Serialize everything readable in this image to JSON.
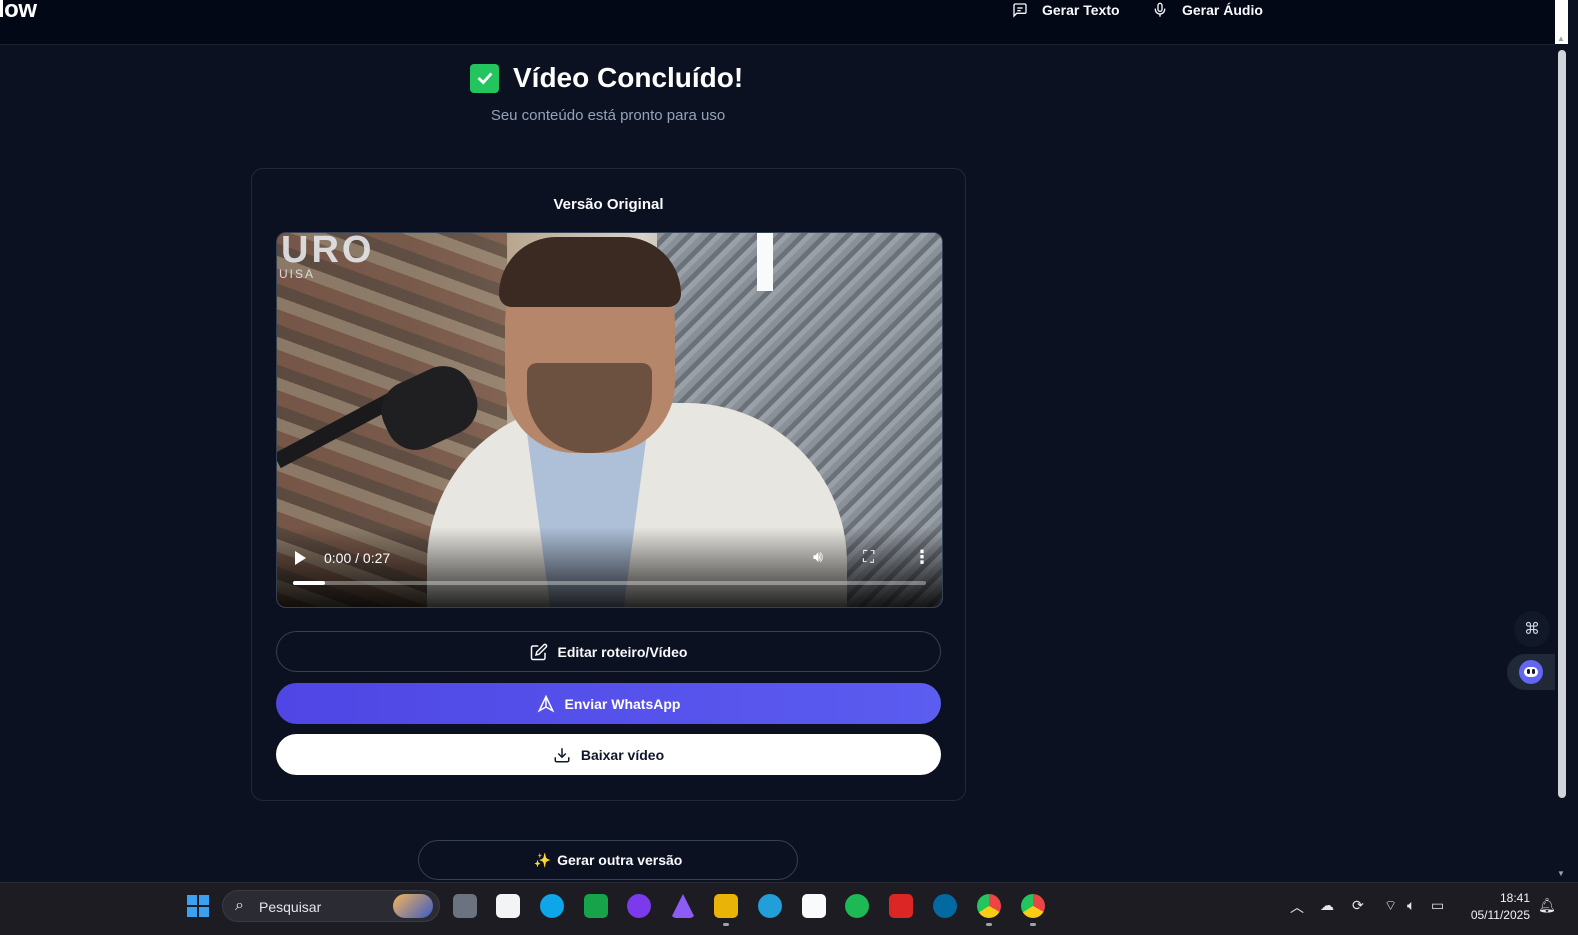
{
  "nav": {
    "brand": "low",
    "gerar_texto": "Gerar Texto",
    "gerar_audio": "Gerar Áudio"
  },
  "hero": {
    "title": "Vídeo Concluído!",
    "subtitle": "Seu conteúdo está pronto para uso"
  },
  "card": {
    "title": "Versão Original",
    "video": {
      "sign_text": "URO",
      "sign_subtext": "UISA",
      "time": "0:00 / 0:27",
      "progress": 0.05
    },
    "buttons": {
      "edit": "Editar roteiro/Vídeo",
      "whatsapp": "Enviar WhatsApp",
      "download": "Baixar vídeo"
    }
  },
  "another_version": {
    "icon": "✨",
    "label": "Gerar outra versão"
  },
  "taskbar": {
    "search_placeholder": "Pesquisar",
    "time": "18:41",
    "date": "05/11/2025"
  },
  "colors": {
    "background": "#0b1120",
    "primary": "#4f46e5",
    "success": "#22c55e"
  }
}
